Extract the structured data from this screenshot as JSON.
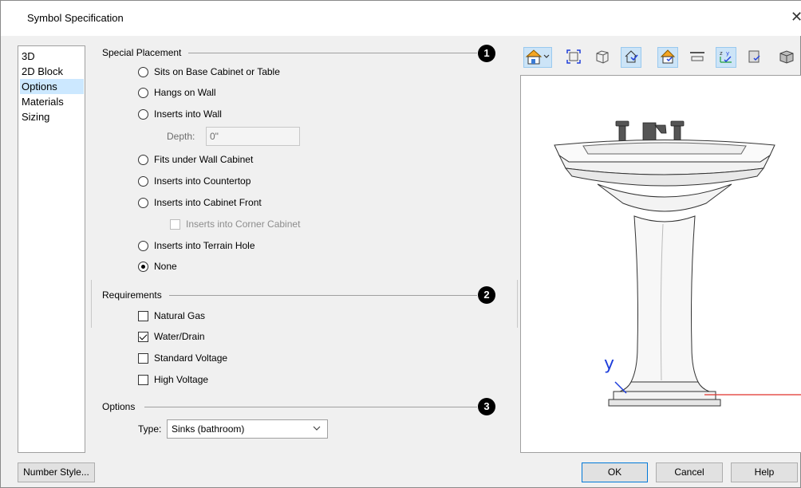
{
  "window": {
    "title": "Symbol Specification",
    "close_glyph": "✕"
  },
  "nav": {
    "items": [
      "3D",
      "2D Block",
      "Options",
      "Materials",
      "Sizing"
    ],
    "selected": "Options"
  },
  "special_placement": {
    "heading": "Special Placement",
    "badge": "1",
    "options": [
      "Sits on Base Cabinet or Table",
      "Hangs on Wall",
      "Inserts into Wall",
      "Fits under Wall Cabinet",
      "Inserts into Countertop",
      "Inserts into Cabinet Front",
      "Inserts into Terrain Hole",
      "None"
    ],
    "selected": "None",
    "depth_label": "Depth:",
    "depth_value": "0\"",
    "corner_cabinet_label": "Inserts into Corner Cabinet"
  },
  "requirements": {
    "heading": "Requirements",
    "badge": "2",
    "items": [
      {
        "label": "Natural Gas",
        "checked": false
      },
      {
        "label": "Water/Drain",
        "checked": true
      },
      {
        "label": "Standard Voltage",
        "checked": false
      },
      {
        "label": "High Voltage",
        "checked": false
      }
    ]
  },
  "options": {
    "heading": "Options",
    "badge": "3",
    "type_label": "Type:",
    "type_value": "Sinks (bathroom)"
  },
  "toolbar": {
    "icons": [
      "render-view-icon",
      "fill-window-icon",
      "wireframe-icon",
      "show-edges-icon",
      "show-texture-icon",
      "show-floor-icon",
      "axes-icon",
      "show-materials-icon",
      "cube-icon"
    ]
  },
  "preview": {
    "axis_label": "y",
    "accent": "#1f3fdb",
    "axis_x_color": "#e0312b"
  },
  "buttons": {
    "number_style": "Number Style...",
    "ok": "OK",
    "cancel": "Cancel",
    "help": "Help"
  }
}
